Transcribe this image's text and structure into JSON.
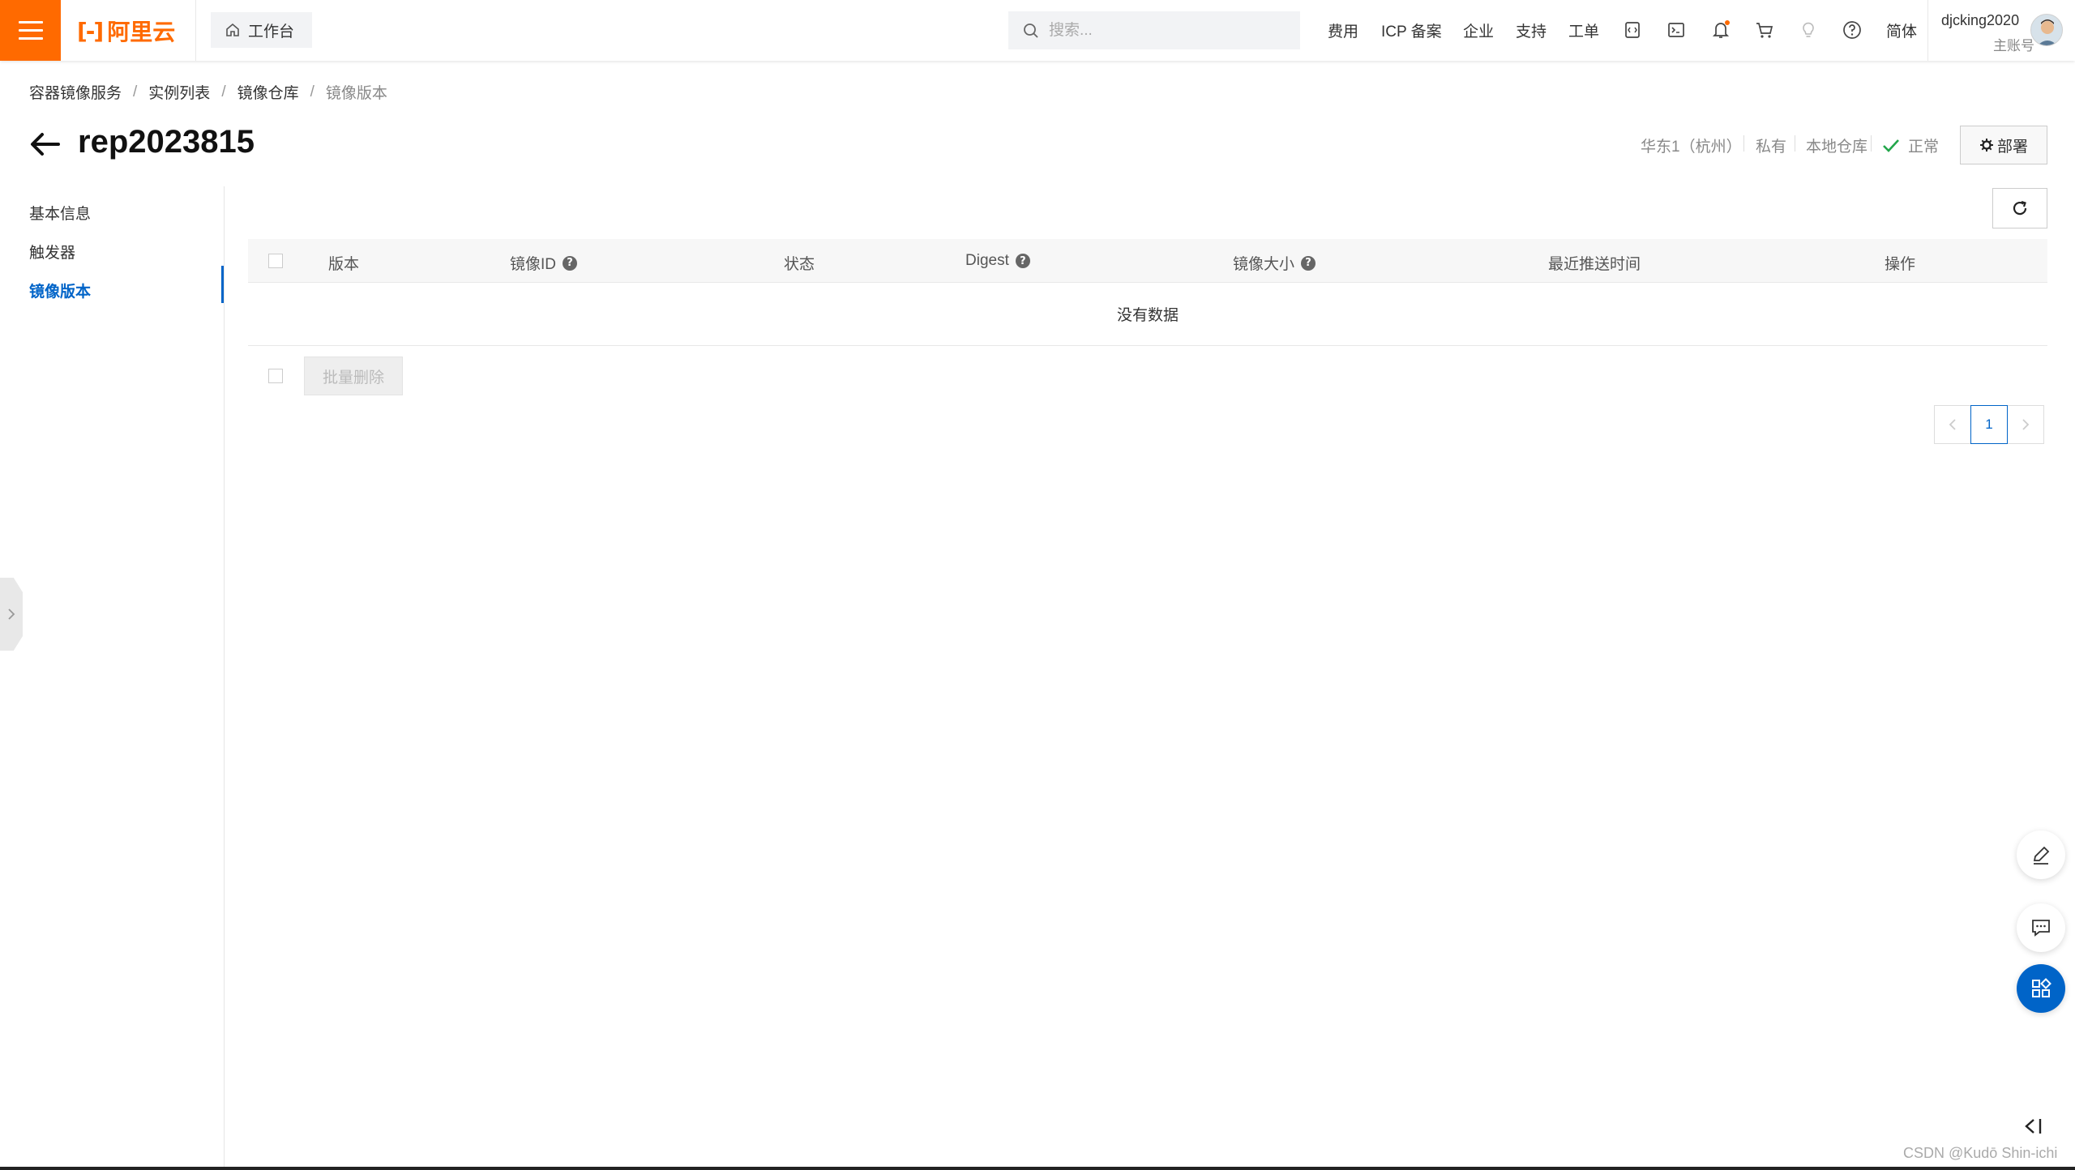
{
  "header": {
    "brand": "阿里云",
    "logo_mark": "[-]",
    "workbench_label": "工作台",
    "search_placeholder": "搜索...",
    "nav": {
      "fee": "费用",
      "icp": "ICP 备案",
      "enterprise": "企业",
      "support": "支持",
      "ticket": "工单",
      "language": "简体"
    },
    "user": {
      "name": "djcking2020",
      "role": "主账号"
    },
    "notification_dot_color": "#ff6a00"
  },
  "breadcrumb": [
    "容器镜像服务",
    "实例列表",
    "镜像仓库",
    "镜像版本"
  ],
  "page": {
    "title": "rep2023815",
    "region": "华东1（杭州）",
    "visibility": "私有",
    "repo_type": "本地仓库",
    "status": "正常",
    "status_color": "#22a64a",
    "deploy_label": "部署"
  },
  "sidebar": {
    "items": [
      {
        "label": "基本信息",
        "active": false
      },
      {
        "label": "触发器",
        "active": false
      },
      {
        "label": "镜像版本",
        "active": true
      }
    ]
  },
  "table": {
    "columns": [
      "版本",
      "镜像ID",
      "状态",
      "Digest",
      "镜像大小",
      "最近推送时间",
      "操作"
    ],
    "help_columns": [
      "镜像ID",
      "Digest",
      "镜像大小"
    ],
    "empty_text": "没有数据",
    "rows": []
  },
  "batch_delete_label": "批量删除",
  "pagination": {
    "current_page": "1"
  },
  "watermark": "CSDN @Kudō Shin-ichi",
  "colors": {
    "brand_orange": "#ff6a00",
    "primary_blue": "#0064c8"
  }
}
